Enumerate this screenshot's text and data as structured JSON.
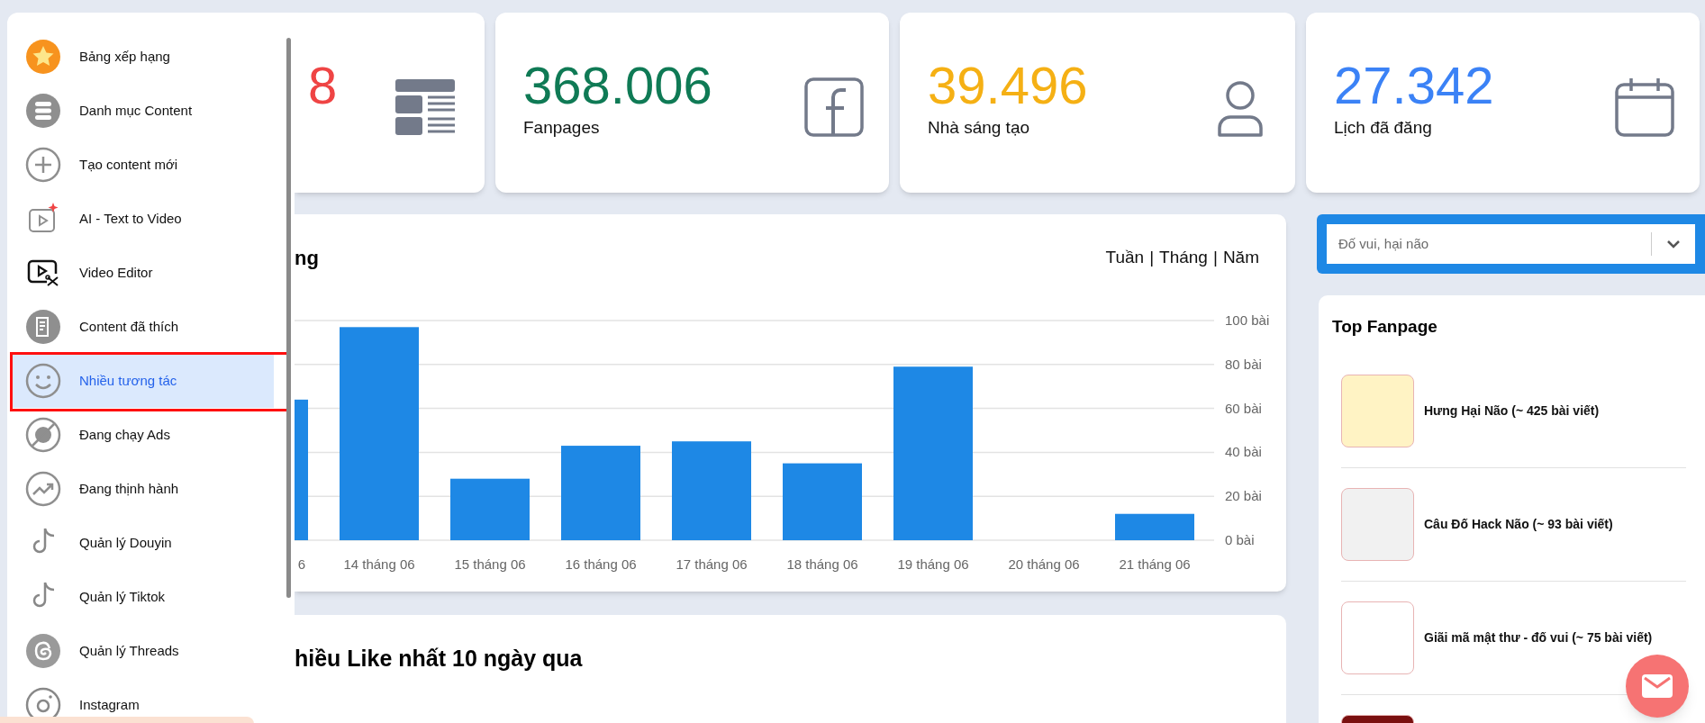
{
  "sidebar": {
    "items": [
      {
        "label": "Bảng xếp hạng",
        "selected": false,
        "outlined": false
      },
      {
        "label": "Danh mục Content",
        "selected": false,
        "outlined": false
      },
      {
        "label": "Tạo content mới",
        "selected": false,
        "outlined": false
      },
      {
        "label": "AI - Text to Video",
        "selected": false,
        "outlined": false
      },
      {
        "label": "Video Editor",
        "selected": false,
        "outlined": false
      },
      {
        "label": "Content đã thích",
        "selected": false,
        "outlined": false
      },
      {
        "label": "Nhiều tương tác",
        "selected": true,
        "outlined": true
      },
      {
        "label": "Đang chạy Ads",
        "selected": false,
        "outlined": false
      },
      {
        "label": "Đang thịnh hành",
        "selected": false,
        "outlined": false
      },
      {
        "label": "Quản lý Douyin",
        "selected": false,
        "outlined": false
      },
      {
        "label": "Quản lý Tiktok",
        "selected": false,
        "outlined": false
      },
      {
        "label": "Quản lý Threads",
        "selected": false,
        "outlined": false
      },
      {
        "label": "Instagram",
        "selected": false,
        "outlined": false
      }
    ]
  },
  "stats": [
    {
      "value": "8",
      "color": "#ef4444"
    },
    {
      "value": "368.006",
      "label": "Fanpages",
      "color": "#0f7a55"
    },
    {
      "value": "39.496",
      "label": "Nhà sáng tạo",
      "color": "#f5b014"
    },
    {
      "value": "27.342",
      "label": "Lịch đã đăng",
      "color": "#3b82f6"
    }
  ],
  "chart_panel": {
    "title": "ng",
    "period_options": [
      {
        "label": "Tuần"
      },
      {
        "label": "Tháng"
      },
      {
        "label": "Năm"
      }
    ],
    "separators": [
      "|",
      "|"
    ],
    "chart_data": {
      "type": "bar",
      "categories": [
        "6",
        "14 tháng 06",
        "15 tháng 06",
        "16 tháng 06",
        "17 tháng 06",
        "18 tháng 06",
        "19 tháng 06",
        "20 tháng 06",
        "21 tháng 06"
      ],
      "series": [
        {
          "color": "#1e88e5",
          "values": [
            64,
            97,
            28,
            43,
            45,
            35,
            79,
            0,
            12
          ]
        }
      ],
      "grid": true,
      "ylim": [
        0,
        100
      ],
      "yticks": [
        {
          "value": 0,
          "label": "0 bài"
        },
        {
          "value": 20,
          "label": "20 bài"
        },
        {
          "value": 40,
          "label": "40 bài"
        },
        {
          "value": 60,
          "label": "60 bài"
        },
        {
          "value": 80,
          "label": "80 bài"
        },
        {
          "value": 100,
          "label": "100 bài"
        }
      ]
    }
  },
  "likes_panel": {
    "title": "hiều Like nhất 10 ngày qua"
  },
  "category_select": {
    "value": "Đố vui, hại não"
  },
  "top_fanpage": {
    "title": "Top Fanpage",
    "items": [
      {
        "name": "Hưng Hại Não (~ 425 bài viết)",
        "color": "#fff3c4"
      },
      {
        "name": "Câu Đố Hack Não (~ 93 bài viết)",
        "color": "#f1f1f1"
      },
      {
        "name": "Giãi mã mật thư - đố vui (~ 75 bài viết)",
        "color": "#ffffff"
      },
      {
        "color": "#7a1010"
      }
    ]
  }
}
